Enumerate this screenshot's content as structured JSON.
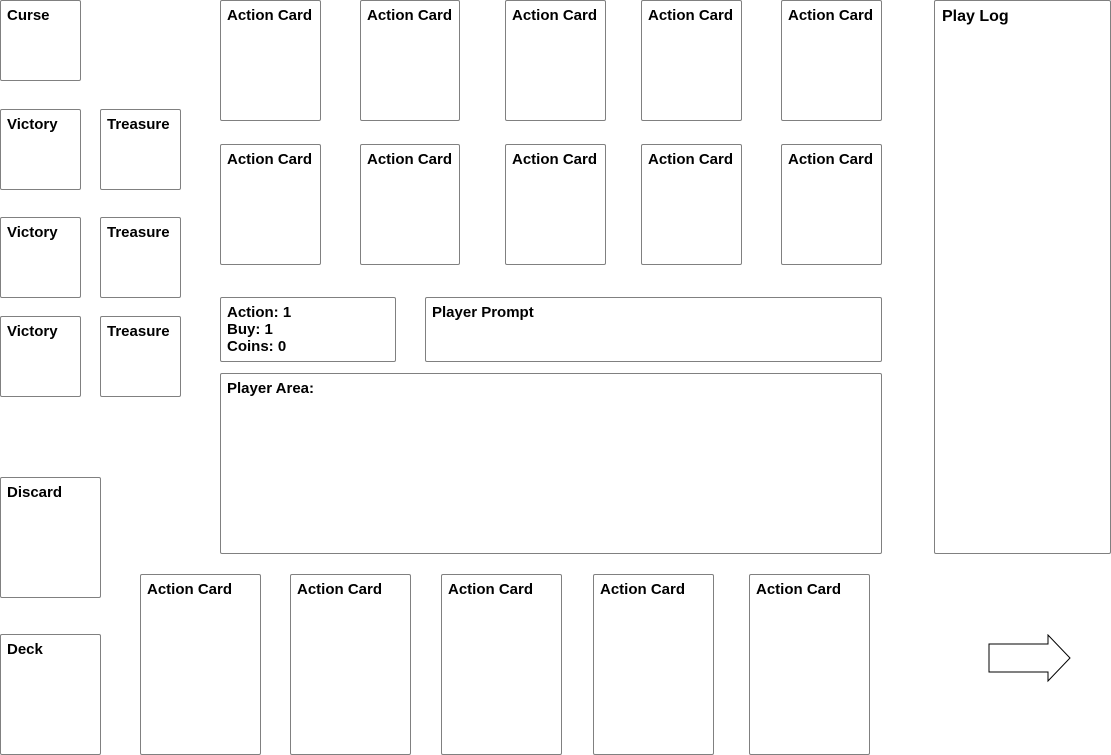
{
  "supply": {
    "curse": "Curse",
    "victory": [
      "Victory",
      "Victory",
      "Victory"
    ],
    "treasure": [
      "Treasure",
      "Treasure",
      "Treasure"
    ]
  },
  "kingdom": {
    "row1": [
      "Action Card",
      "Action Card",
      "Action Card",
      "Action Card",
      "Action Card"
    ],
    "row2": [
      "Action Card",
      "Action Card",
      "Action Card",
      "Action Card",
      "Action Card"
    ]
  },
  "status": {
    "action": "Action: 1",
    "buy": "Buy: 1",
    "coins": "Coins: 0"
  },
  "prompt": {
    "label": "Player Prompt"
  },
  "player_area": {
    "label": "Player Area:"
  },
  "play_log": {
    "label": "Play Log"
  },
  "piles": {
    "discard": "Discard",
    "deck": "Deck"
  },
  "hand": [
    "Action Card",
    "Action Card",
    "Action Card",
    "Action Card",
    "Action Card"
  ],
  "icons": {
    "next": "right-arrow-icon"
  }
}
